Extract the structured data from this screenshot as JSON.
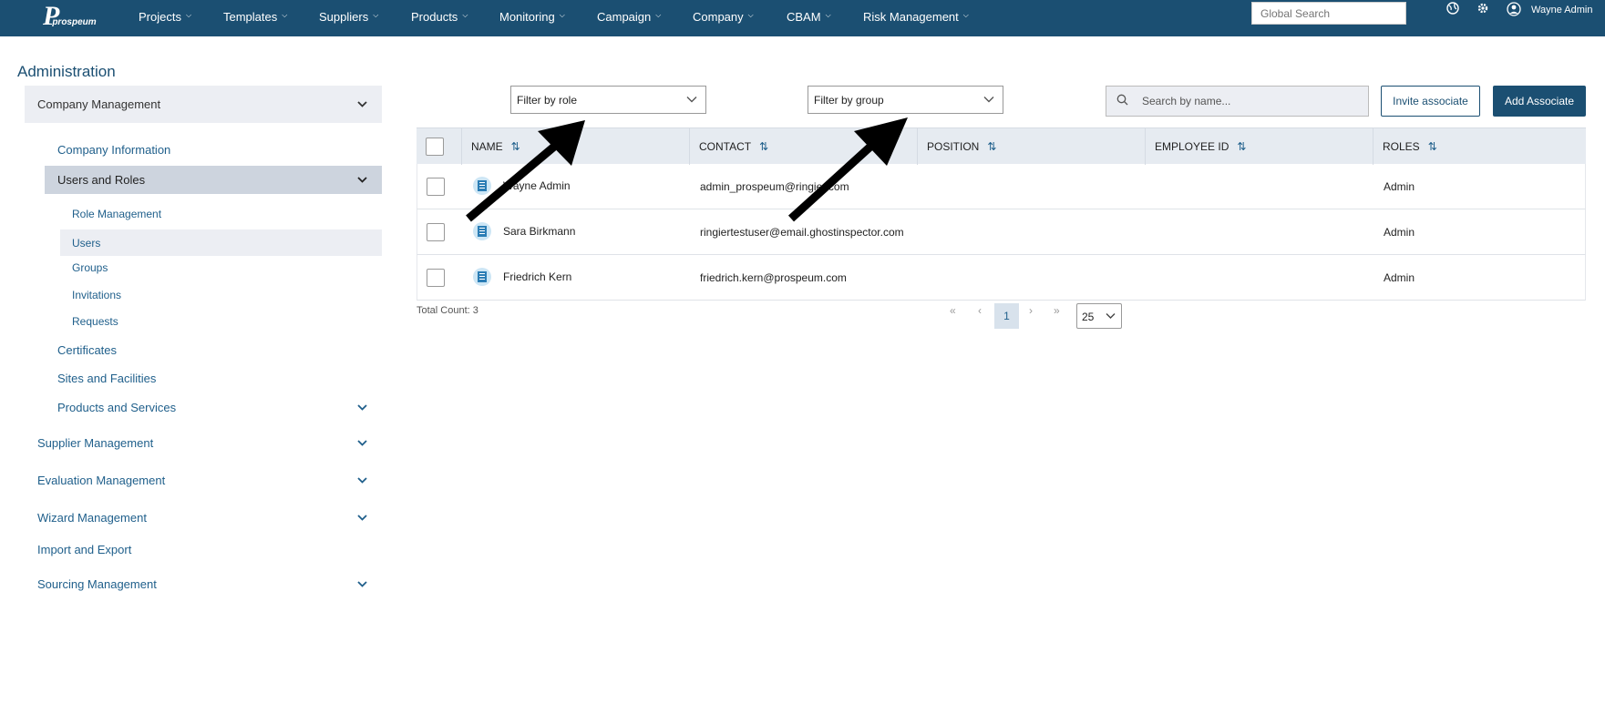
{
  "brand": {
    "logo_text": "prospeum"
  },
  "nav": {
    "items": [
      "Projects",
      "Templates",
      "Suppliers",
      "Products",
      "Monitoring",
      "Campaign",
      "Company",
      "CBAM",
      "Risk Management"
    ],
    "search_placeholder": "Global Search",
    "username": "Wayne Admin"
  },
  "sidebar": {
    "title": "Administration",
    "company_management": "Company Management",
    "company_information": "Company Information",
    "users_and_roles": "Users and Roles",
    "role_management": "Role Management",
    "users": "Users",
    "groups": "Groups",
    "invitations": "Invitations",
    "requests": "Requests",
    "certificates": "Certificates",
    "sites_and_facilities": "Sites and Facilities",
    "products_and_services": "Products and Services",
    "supplier_management": "Supplier Management",
    "evaluation_management": "Evaluation Management",
    "wizard_management": "Wizard Management",
    "import_and_export": "Import and Export",
    "sourcing_management": "Sourcing Management"
  },
  "toolbar": {
    "filter_role": "Filter by role",
    "filter_group": "Filter by group",
    "search_placeholder": "Search by name...",
    "invite_label": "Invite associate",
    "add_label": "Add Associate"
  },
  "table": {
    "headers": [
      "NAME",
      "CONTACT",
      "POSITION",
      "EMPLOYEE ID",
      "ROLES"
    ],
    "rows": [
      {
        "name": "Wayne Admin",
        "contact": "admin_prospeum@ringier.com",
        "position": "",
        "employee_id": "",
        "roles": "Admin"
      },
      {
        "name": "Sara Birkmann",
        "contact": "ringiertestuser@email.ghostinspector.com",
        "position": "",
        "employee_id": "",
        "roles": "Admin"
      },
      {
        "name": "Friedrich Kern",
        "contact": "friedrich.kern@prospeum.com",
        "position": "",
        "employee_id": "",
        "roles": "Admin"
      }
    ]
  },
  "pagination": {
    "total_label": "Total Count: 3",
    "current_page": "1",
    "page_size": "25"
  },
  "colors": {
    "primary": "#1b4f72",
    "link": "#1f5f8b",
    "header_bg": "#e6ebf1"
  }
}
